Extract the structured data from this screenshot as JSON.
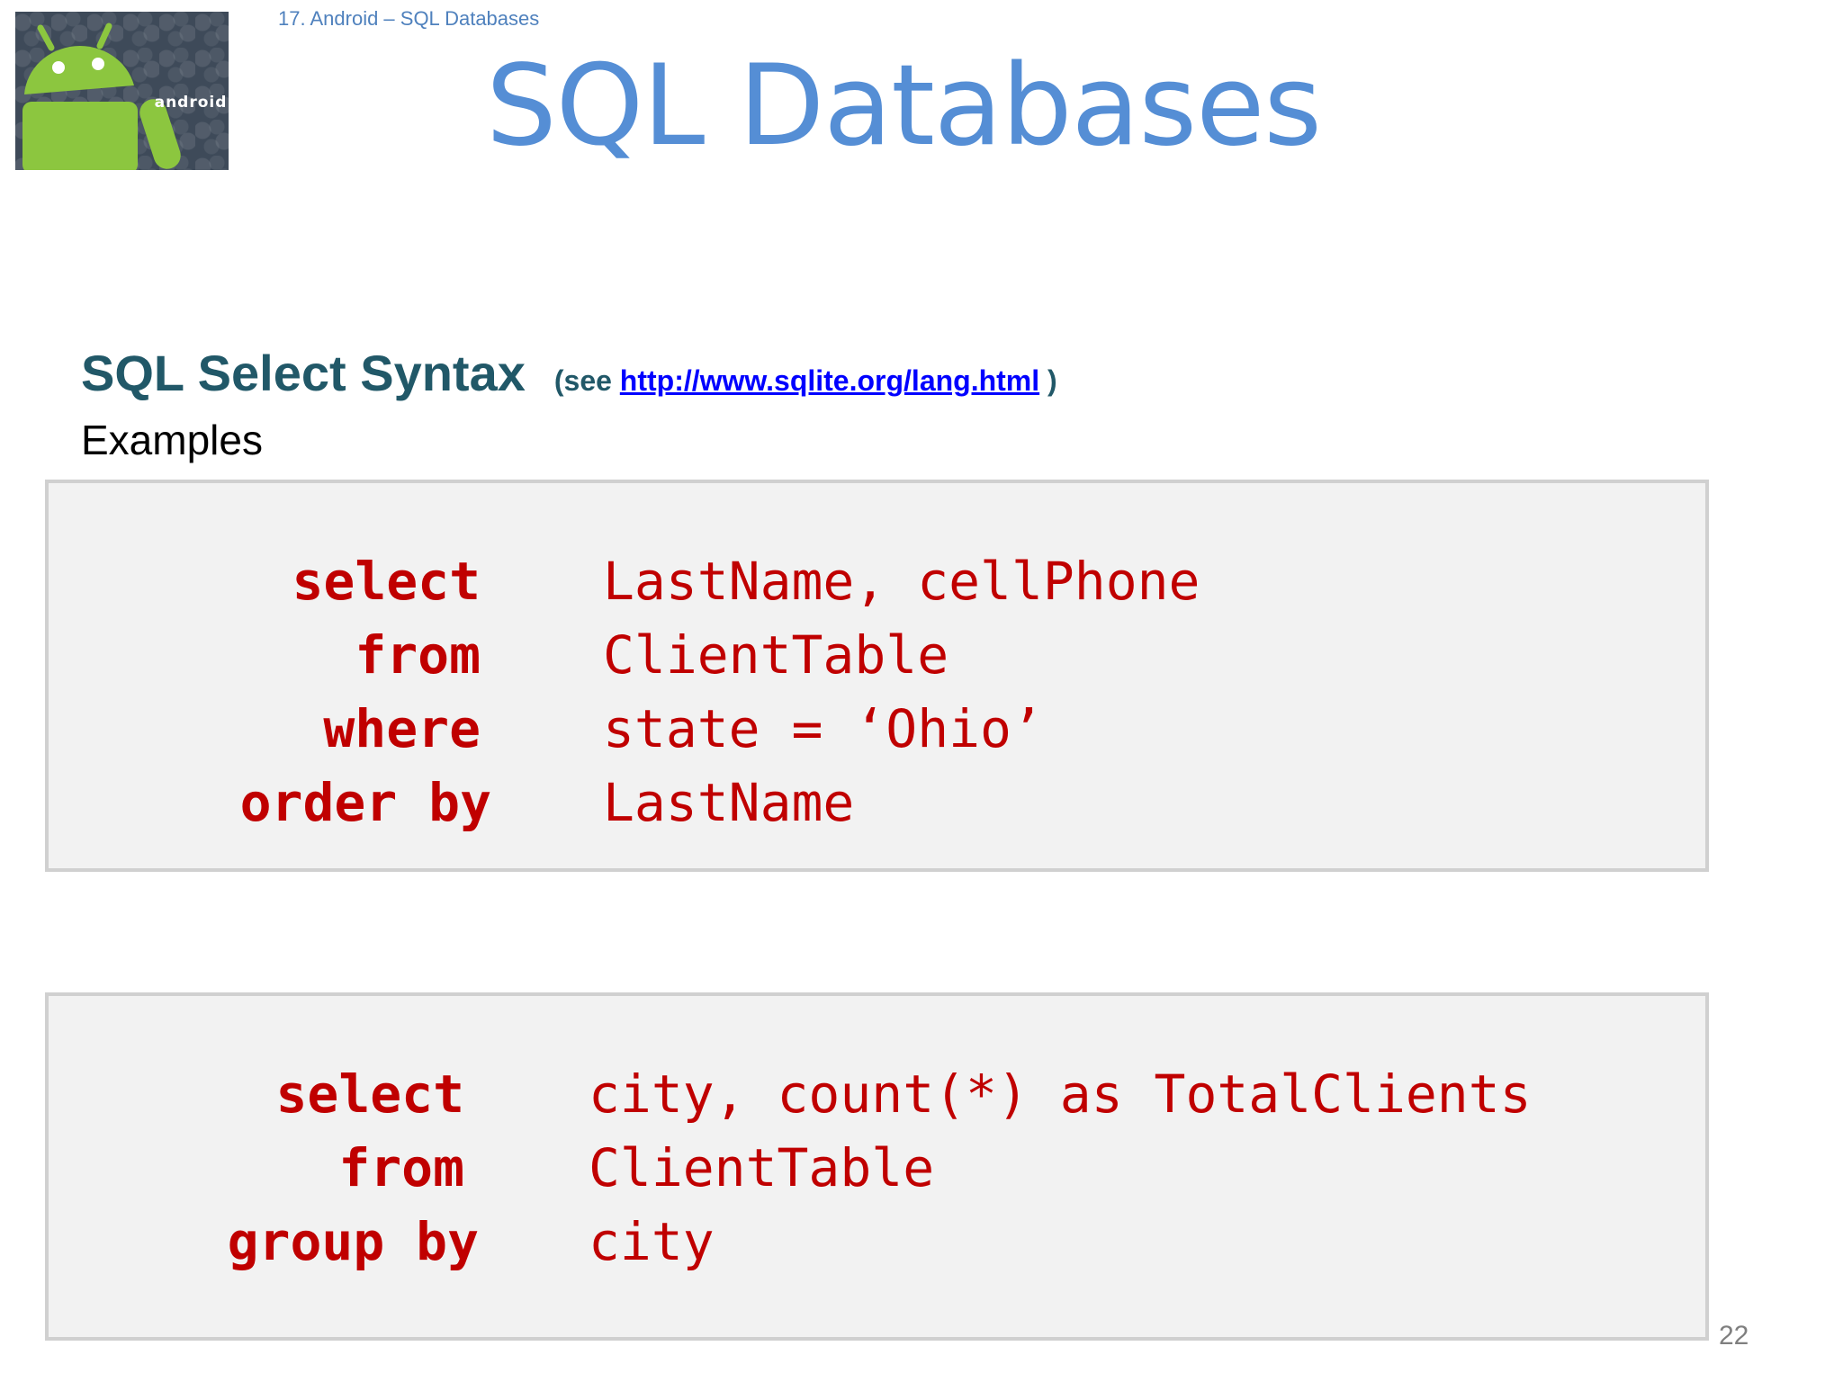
{
  "header": {
    "breadcrumb": "17. Android – SQL Databases",
    "title": "SQL Databases",
    "logo_text": "android"
  },
  "section": {
    "title": "SQL Select Syntax",
    "see_prefix": "(see ",
    "see_link": "http://www.sqlite.org/lang.html",
    "see_suffix": " )",
    "examples_label": "Examples"
  },
  "examples": [
    {
      "lines": [
        {
          "keyword": "select",
          "value": "LastName, cellPhone"
        },
        {
          "keyword": "from",
          "value": "ClientTable"
        },
        {
          "keyword": "where",
          "value": "state = ‘Ohio’"
        },
        {
          "keyword": "order by",
          "value": "LastName"
        }
      ]
    },
    {
      "lines": [
        {
          "keyword": "select",
          "value": "city, count(*) as TotalClients"
        },
        {
          "keyword": "from",
          "value": "ClientTable"
        },
        {
          "keyword": "group by",
          "value": "city"
        }
      ]
    }
  ],
  "footer": {
    "page_number": "22"
  },
  "colors": {
    "title": "#558ed5",
    "section_title": "#215868",
    "code": "#c00000",
    "link": "#0000ff",
    "breadcrumb": "#4f81bd"
  }
}
